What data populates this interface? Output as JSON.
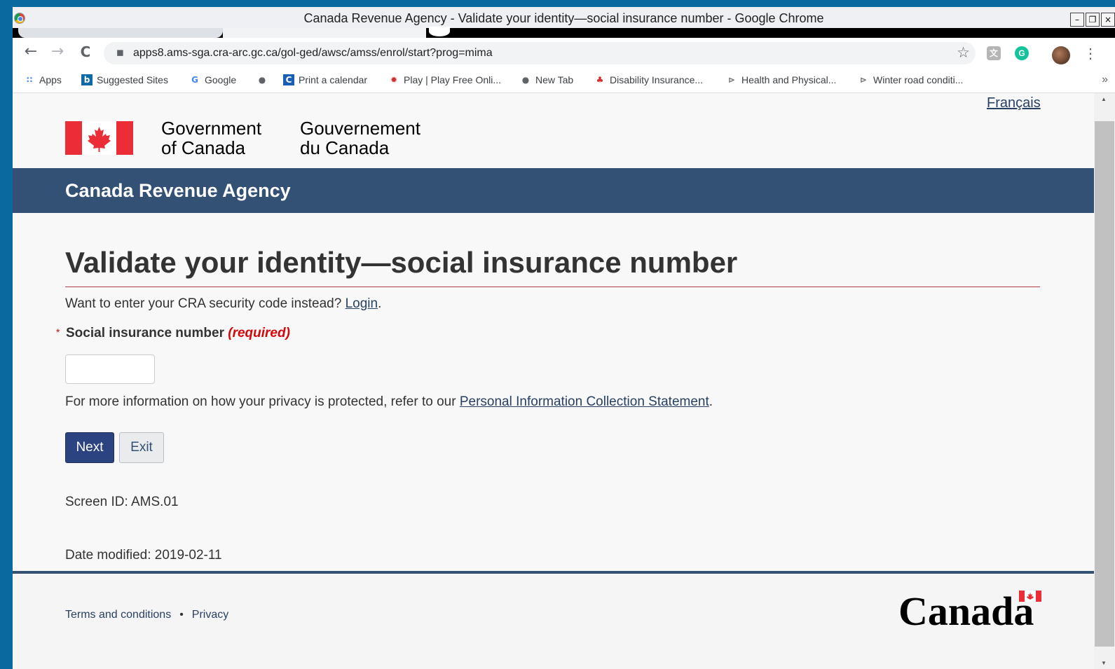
{
  "window": {
    "title": "Canada Revenue Agency - Validate your identity—social insurance number - Google Chrome",
    "buttons": {
      "minimize": "–",
      "restore": "❐",
      "close": "×"
    }
  },
  "toolbar": {
    "back": "←",
    "forward": "→",
    "reload": "C",
    "url": "apps8.ams-sga.cra-arc.gc.ca/gol-ged/awsc/amss/enrol/start?prog=mima",
    "star": "☆",
    "extensions": [
      {
        "icon": "translate-extension-icon",
        "glyph": "文",
        "color": "#a5a5a5"
      },
      {
        "icon": "grammarly-icon",
        "glyph": "G",
        "color": "#15c39a"
      }
    ],
    "menu": "⋮"
  },
  "bookmarks": [
    {
      "label": "Apps",
      "icon": "apps-grid-icon",
      "glyph": "∷",
      "color": "#4285f4"
    },
    {
      "label": "Suggested Sites",
      "icon": "bing-icon",
      "glyph": "b",
      "color": "#0c6aa8"
    },
    {
      "label": "Google",
      "icon": "google-icon",
      "glyph": "G",
      "color": "#4285f4"
    },
    {
      "label": "",
      "icon": "globe-icon",
      "glyph": "●",
      "color": "#5f6368"
    },
    {
      "label": "Print a calendar",
      "icon": "calendar-site-icon",
      "glyph": "C",
      "color": "#1a5fb4"
    },
    {
      "label": "Play | Play Free Onli...",
      "icon": "cbc-gem-icon",
      "glyph": "✹",
      "color": "#d12d2d"
    },
    {
      "label": "New Tab",
      "icon": "globe-icon",
      "glyph": "●",
      "color": "#5f6368"
    },
    {
      "label": "Disability Insurance...",
      "icon": "maple-leaf-icon",
      "glyph": "♣",
      "color": "#d12d2d"
    },
    {
      "label": "Health and Physical...",
      "icon": "feather-icon",
      "glyph": "⊳",
      "color": "#777"
    },
    {
      "label": "Winter road conditi...",
      "icon": "feather-icon",
      "glyph": "⊳",
      "color": "#777"
    }
  ],
  "bookmarks_more": "»",
  "header": {
    "language_link": "Français",
    "gov_en_line1": "Government",
    "gov_en_line2": "of Canada",
    "gov_fr_line1": "Gouvernement",
    "gov_fr_line2": "du Canada",
    "agency": "Canada Revenue Agency"
  },
  "main": {
    "title": "Validate your identity—social insurance number",
    "alt_prompt": "Want to enter your CRA security code instead?",
    "alt_link": "Login",
    "alt_suffix": ".",
    "required_marker": "*",
    "field_label": "Social insurance number",
    "field_required": "(required)",
    "field_value": "",
    "privacy_prefix": "For more information on how your privacy is protected, refer to our",
    "privacy_link": "Personal Information Collection Statement",
    "privacy_suffix": ".",
    "next_label": "Next",
    "exit_label": "Exit",
    "screen_id": "Screen ID: AMS.01",
    "date_modified": "Date modified: 2019-02-11"
  },
  "footer": {
    "terms": "Terms and conditions",
    "separator": "•",
    "privacy": "Privacy",
    "wordmark": "Canada"
  },
  "colors": {
    "banner": "#335075",
    "accent_rule": "#af3c43",
    "required_red": "#d3080c",
    "button_primary": "#2b4380"
  }
}
